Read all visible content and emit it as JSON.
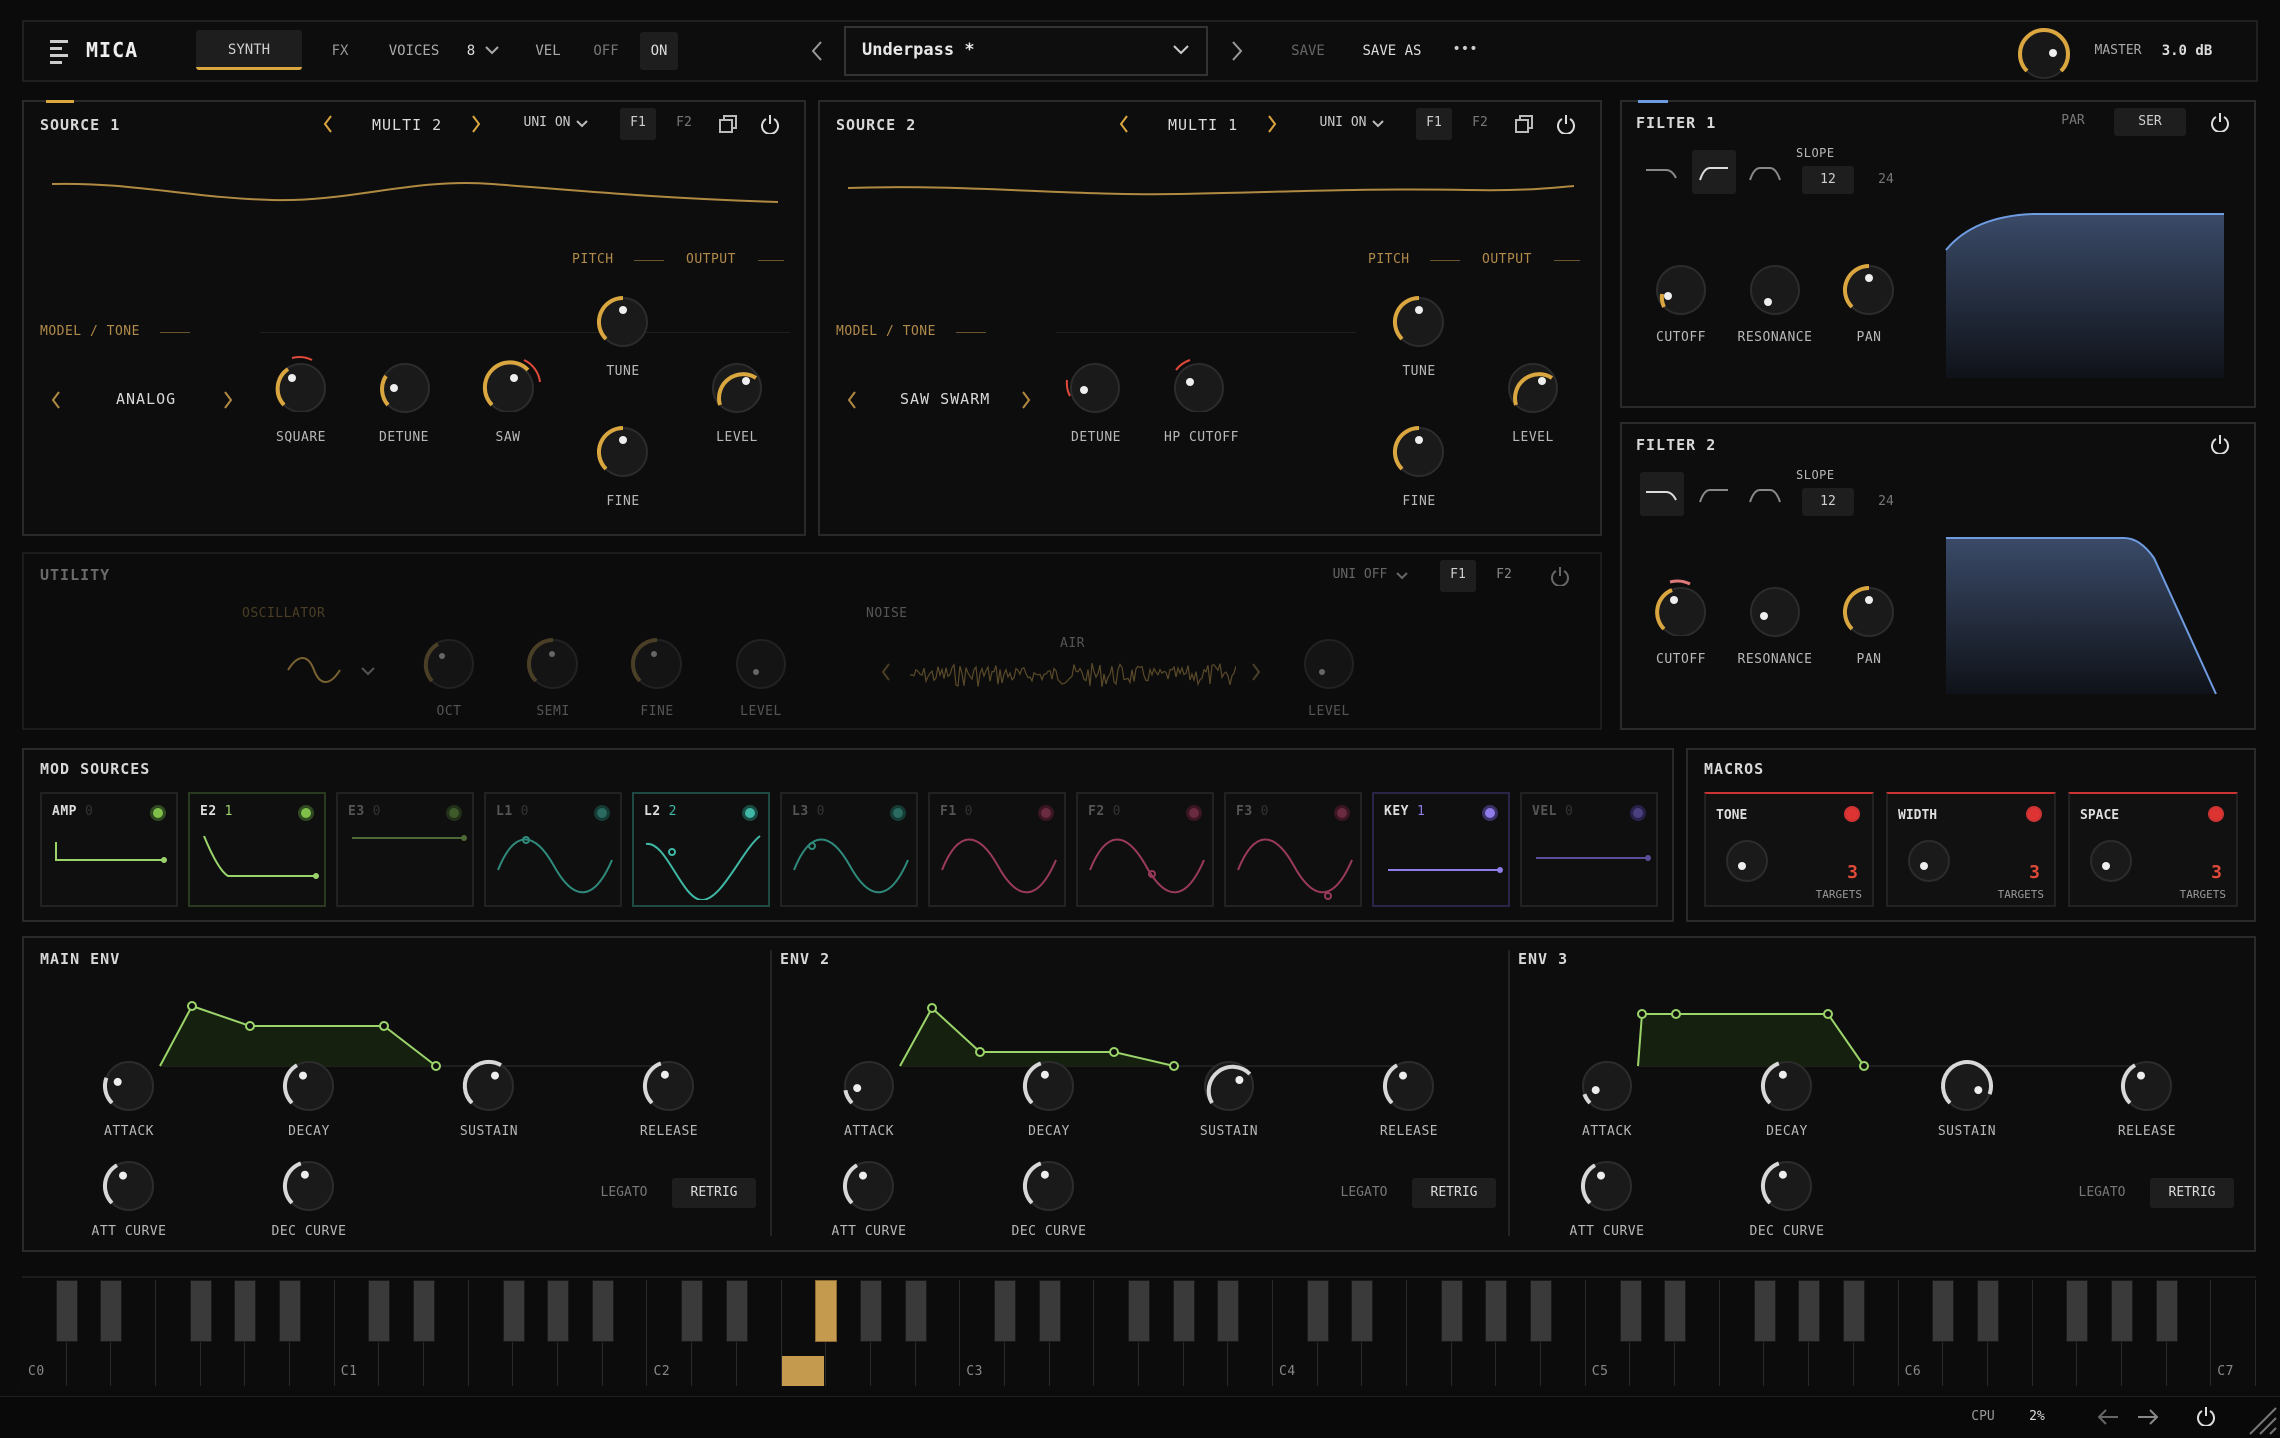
{
  "app": {
    "name": "MICA"
  },
  "topbar": {
    "tab_synth": "SYNTH",
    "tab_fx": "FX",
    "voices_label": "VOICES",
    "voices_value": "8",
    "vel_label": "VEL",
    "off": "OFF",
    "on": "ON",
    "preset_name": "Underpass *",
    "save": "SAVE",
    "save_as": "SAVE AS",
    "more": "•••",
    "master_label": "MASTER",
    "master_value": "3.0 dB"
  },
  "source1": {
    "title": "SOURCE 1",
    "engine": "MULTI 2",
    "uni": "UNI ON",
    "f1": "F1",
    "f2": "F2",
    "pitch": "PITCH",
    "output": "OUTPUT",
    "model_tone": "MODEL / TONE",
    "model": "ANALOG",
    "knobs": {
      "square": "SQUARE",
      "detune": "DETUNE",
      "saw": "SAW",
      "tune": "TUNE",
      "fine": "FINE",
      "level": "LEVEL"
    }
  },
  "source2": {
    "title": "SOURCE 2",
    "engine": "MULTI 1",
    "uni": "UNI ON",
    "f1": "F1",
    "f2": "F2",
    "pitch": "PITCH",
    "output": "OUTPUT",
    "model_tone": "MODEL / TONE",
    "model": "SAW SWARM",
    "knobs": {
      "detune": "DETUNE",
      "hp_cutoff": "HP CUTOFF",
      "tune": "TUNE",
      "fine": "FINE",
      "level": "LEVEL"
    }
  },
  "utility": {
    "title": "UTILITY",
    "uni": "UNI OFF",
    "f1": "F1",
    "f2": "F2",
    "oscillator": "OSCILLATOR",
    "noise": "NOISE",
    "air": "AIR",
    "knobs": {
      "oct": "OCT",
      "semi": "SEMI",
      "fine": "FINE",
      "level": "LEVEL",
      "noise_level": "LEVEL"
    }
  },
  "filter1": {
    "title": "FILTER 1",
    "par": "PAR",
    "ser": "SER",
    "slope": "SLOPE",
    "slope_12": "12",
    "slope_24": "24",
    "knobs": {
      "cutoff": "CUTOFF",
      "resonance": "RESONANCE",
      "pan": "PAN"
    }
  },
  "filter2": {
    "title": "FILTER 2",
    "slope": "SLOPE",
    "slope_12": "12",
    "slope_24": "24",
    "knobs": {
      "cutoff": "CUTOFF",
      "resonance": "RESONANCE",
      "pan": "PAN"
    }
  },
  "mod_sources": {
    "title": "MOD SOURCES",
    "items": [
      {
        "name": "AMP",
        "count": "0"
      },
      {
        "name": "E2",
        "count": "1"
      },
      {
        "name": "E3",
        "count": "0"
      },
      {
        "name": "L1",
        "count": "0"
      },
      {
        "name": "L2",
        "count": "2"
      },
      {
        "name": "L3",
        "count": "0"
      },
      {
        "name": "F1",
        "count": "0"
      },
      {
        "name": "F2",
        "count": "0"
      },
      {
        "name": "F3",
        "count": "0"
      },
      {
        "name": "KEY",
        "count": "1"
      },
      {
        "name": "VEL",
        "count": "0"
      }
    ]
  },
  "macros": {
    "title": "MACROS",
    "items": [
      {
        "name": "TONE",
        "targets": "3",
        "label": "TARGETS"
      },
      {
        "name": "WIDTH",
        "targets": "3",
        "label": "TARGETS"
      },
      {
        "name": "SPACE",
        "targets": "3",
        "label": "TARGETS"
      }
    ]
  },
  "envs": [
    {
      "title": "MAIN ENV",
      "attack": "ATTACK",
      "decay": "DECAY",
      "sustain": "SUSTAIN",
      "release": "RELEASE",
      "att_curve": "ATT CURVE",
      "dec_curve": "DEC CURVE",
      "legato": "LEGATO",
      "retrig": "RETRIG"
    },
    {
      "title": "ENV 2",
      "attack": "ATTACK",
      "decay": "DECAY",
      "sustain": "SUSTAIN",
      "release": "RELEASE",
      "att_curve": "ATT CURVE",
      "dec_curve": "DEC CURVE",
      "legato": "LEGATO",
      "retrig": "RETRIG"
    },
    {
      "title": "ENV 3",
      "attack": "ATTACK",
      "decay": "DECAY",
      "sustain": "SUSTAIN",
      "release": "RELEASE",
      "att_curve": "ATT CURVE",
      "dec_curve": "DEC CURVE",
      "legato": "LEGATO",
      "retrig": "RETRIG"
    }
  ],
  "keyboard": {
    "octaves": [
      "C0",
      "C1",
      "C2",
      "C3",
      "C4",
      "C5",
      "C6",
      "C7"
    ]
  },
  "status": {
    "cpu_label": "CPU",
    "cpu_value": "2%"
  },
  "colors": {
    "accent": "#d9a640",
    "filter": "#6f9be0",
    "env": "#9bd46a",
    "lfo": "#3fb9a6",
    "macro": "#e04a3a",
    "key": "#8f7ce8"
  }
}
